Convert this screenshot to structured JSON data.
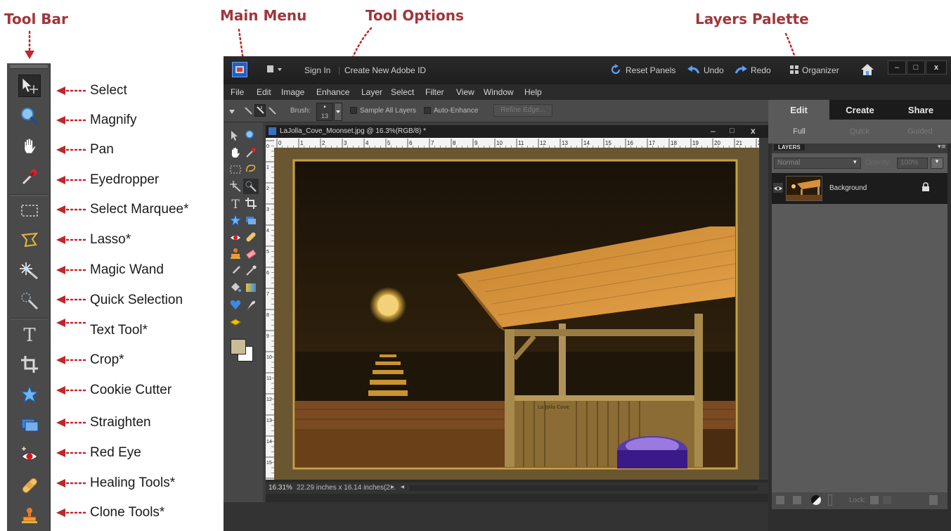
{
  "annotations": {
    "tool_bar": "Tool Bar",
    "main_menu": "Main  Menu",
    "tool_options": "Tool Options",
    "layers_palette": "Layers Palette"
  },
  "tool_labels": [
    "Select",
    "Magnify",
    "Pan",
    "Eyedropper",
    "Select Marquee*",
    "Lasso*",
    "Magic Wand",
    "Quick Selection",
    "Text Tool*",
    "Crop*",
    "Cookie Cutter",
    "Straighten",
    "Red Eye",
    "Healing Tools*",
    "Clone Tools*"
  ],
  "titlebar": {
    "sign_in": "Sign In",
    "create_id": "Create New Adobe ID",
    "reset_panels": "Reset Panels",
    "undo": "Undo",
    "redo": "Redo",
    "organizer": "Organizer",
    "minimize": "–",
    "maximize": "□",
    "close": "x"
  },
  "menu": [
    "File",
    "Edit",
    "Image",
    "Enhance",
    "Layer",
    "Select",
    "Filter",
    "View",
    "Window",
    "Help"
  ],
  "options": {
    "brush_label": "Brush:",
    "brush_size": "13",
    "sample_all_layers": "Sample All Layers",
    "auto_enhance": "Auto-Enhance",
    "refine_edge": "Refine Edge..."
  },
  "document": {
    "title": "LaJolla_Cove_Moonset.jpg @ 16.3%(RGB/8) *",
    "zoom": "16.31%",
    "dimensions": "22.29 inches x 16.14 inches(2...",
    "ruler_numbers": [
      "0",
      "1",
      "2",
      "3",
      "4",
      "5",
      "6",
      "7",
      "8",
      "9",
      "10",
      "11",
      "12",
      "13",
      "14",
      "15",
      "16",
      "17",
      "18",
      "19",
      "20",
      "21",
      "2"
    ],
    "ruler_v_numbers": [
      "0",
      "1",
      "2",
      "3",
      "4",
      "5",
      "6",
      "7",
      "8",
      "9",
      "10",
      "11",
      "12",
      "13",
      "14",
      "15",
      "16"
    ],
    "sign_text": "La Jolla Cove"
  },
  "panels": {
    "tabs": [
      "Edit",
      "Create",
      "Share"
    ],
    "subtabs": [
      "Full",
      "Quick",
      "Guided"
    ],
    "layers_header": "LAYERS",
    "blend_mode": "Normal",
    "opacity_label": "Opacity:",
    "opacity_value": "100%",
    "layer_name": "Background",
    "lock_label": "Lock:"
  },
  "colors": {
    "annotation": "#a0363a",
    "app_bg": "#3d3d3d",
    "foreground_color": "#c8bd94",
    "background_color": "#ffffff"
  }
}
